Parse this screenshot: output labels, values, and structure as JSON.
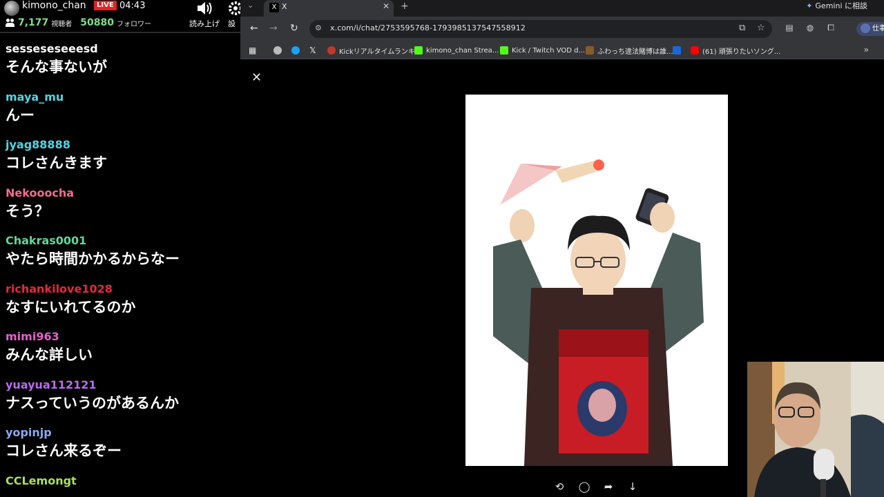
{
  "stream": {
    "channel": "kimono_chan",
    "live_label": "LIVE",
    "elapsed": "04:43",
    "viewers": "7,177",
    "viewers_label": "視聴者",
    "followers": "50880",
    "followers_label": "フォロワー",
    "read_aloud_label": "読み上げ",
    "settings_label": "設"
  },
  "chat": [
    {
      "user": "sesseseseeesd",
      "text": "そんな事ないが",
      "color": "#ffffff"
    },
    {
      "user": "maya_mu",
      "text": "んー",
      "color": "#4fd6e6"
    },
    {
      "user": "jyag88888",
      "text": "コレさんきます",
      "color": "#4fd6e6"
    },
    {
      "user": "Nekooocha",
      "text": "そう？",
      "color": "#f06d8f"
    },
    {
      "user": "Chakras0001",
      "text": "やたら時間かかるからなー",
      "color": "#5fd89a"
    },
    {
      "user": "richankilove1028",
      "text": "なすにいれてるのか",
      "color": "#e8283c"
    },
    {
      "user": "mimi963",
      "text": "みんな詳しい",
      "color": "#e45ecf"
    },
    {
      "user": "yuayua112121",
      "text": "ナスっていうのがあるんか",
      "color": "#b86cf0"
    },
    {
      "user": "yopinjp",
      "text": "コレさん来るぞー",
      "color": "#8aa8f0"
    },
    {
      "user": "CCLemongt",
      "text": "",
      "color": "#a8e05e"
    }
  ],
  "browser": {
    "tab_title": "X",
    "tab_favicon": "X",
    "gemini_label": "Gemini に相談",
    "url": "x.com/i/chat/2753595768-1793985137547558912",
    "profile_label": "仕事",
    "bookmarks": [
      {
        "label": "",
        "icon": "apps-grid-icon",
        "color": "#e3e3e3"
      },
      {
        "label": "",
        "icon": "bookmark-icon-1",
        "color": "#bbbbbb"
      },
      {
        "label": "",
        "icon": "bookmark-icon-2",
        "color": "#1da1f2"
      },
      {
        "label": "",
        "icon": "x-logo-icon",
        "color": "#ffffff"
      },
      {
        "label": "Kickリアルタイムランキ...",
        "icon": "kick-ranking-icon",
        "color": "#c0392b"
      },
      {
        "label": "kimono_chan Strea...",
        "icon": "kick-icon",
        "color": "#53fc18"
      },
      {
        "label": "Kick / Twitch VOD d...",
        "icon": "vod-icon",
        "color": "#53fc18"
      },
      {
        "label": "ふわっち違法賭博は誰...",
        "icon": "fuwacchi-icon",
        "color": "#8a5a2b"
      },
      {
        "label": "",
        "icon": "trello-icon",
        "color": "#1868db"
      },
      {
        "label": "(61) 頑張りたいソング...",
        "icon": "youtube-icon",
        "color": "#ff0000"
      }
    ]
  },
  "colors": {
    "live": "#e52222",
    "count_green": "#7ee08a",
    "browser_chrome": "#35363a",
    "tabstrip": "#1b1b1d"
  }
}
